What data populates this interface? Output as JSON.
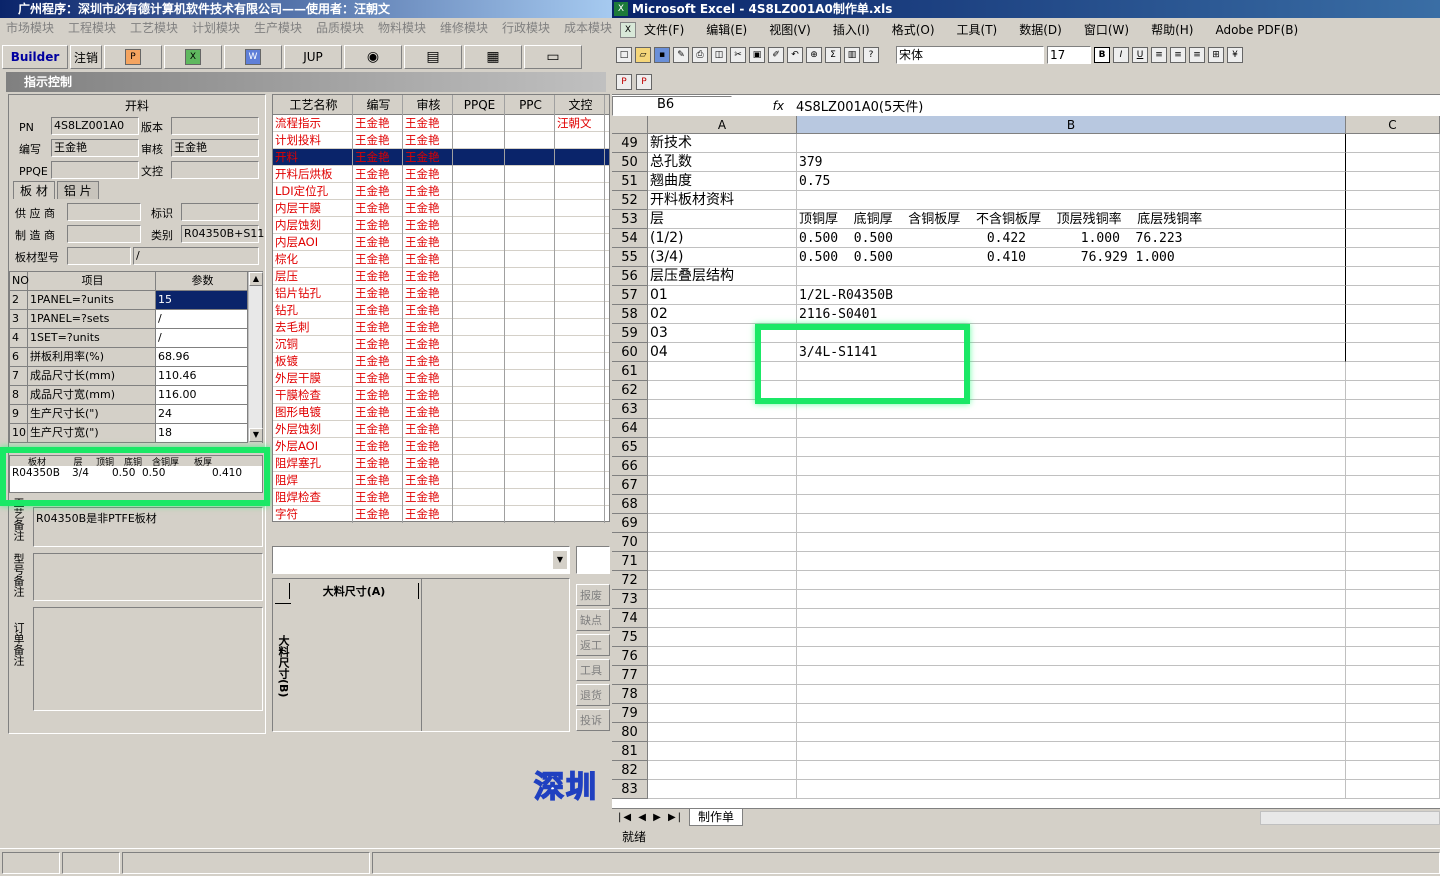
{
  "left": {
    "title": "广州程序：深圳市必有德计算机软件技术有限公司——使用者：汪朝文",
    "menu": [
      "市场模块",
      "工程模块",
      "工艺模块",
      "计划模块",
      "生产模块",
      "品质模块",
      "物料模块",
      "维修模块",
      "行政模块",
      "成本模块"
    ],
    "toolbar": {
      "builder": "Builder",
      "cancel": "注销",
      "jup": "JUP"
    },
    "panel_title": "指示控制",
    "kailiao_header": "开料",
    "form": {
      "pn_label": "PN",
      "pn_value": "4S8LZ001A0",
      "version_label": "版本",
      "editor_label": "编写",
      "editor_value": "王金艳",
      "reviewer_label": "审核",
      "reviewer_value": "王金艳",
      "ppqe_label": "PPQE",
      "wenkong_label": "文控"
    },
    "tabs": [
      "板 材",
      "铝 片"
    ],
    "supplier_label": "供 应 商",
    "mark_label": "标识",
    "maker_label": "制 造 商",
    "type_label": "类别",
    "type_value": "R04350B+S11",
    "model_label": "板材型号",
    "model_value": "/",
    "params_headers": [
      "NO",
      "项目",
      "参数"
    ],
    "params": [
      {
        "no": "2",
        "item": "1PANEL=?units",
        "val": "15"
      },
      {
        "no": "3",
        "item": "1PANEL=?sets",
        "val": "/"
      },
      {
        "no": "4",
        "item": "1SET=?units",
        "val": "/"
      },
      {
        "no": "6",
        "item": "拼板利用率(%)",
        "val": "68.96"
      },
      {
        "no": "7",
        "item": "成品尺寸长(mm)",
        "val": "110.46"
      },
      {
        "no": "8",
        "item": "成品尺寸宽(mm)",
        "val": "116.00"
      },
      {
        "no": "9",
        "item": "生产尺寸长(\")",
        "val": "24"
      },
      {
        "no": "10",
        "item": "生产尺寸宽(\")",
        "val": "18"
      }
    ],
    "mat_headers": [
      "板材",
      "层",
      "顶铜",
      "底铜",
      "含铜厚",
      "板厚"
    ],
    "mat_row": {
      "board": "R04350B",
      "layer": "3/4",
      "top": "0.50",
      "bottom": "0.50",
      "thick": "0.410"
    },
    "note1": "R04350B是非PTFE板材",
    "side_labels": [
      "工艺备注",
      "型号备注",
      "订单备注"
    ],
    "proc_headers": [
      "工艺名称",
      "编写",
      "审核",
      "PPQE",
      "PPC",
      "文控"
    ],
    "processes": [
      "流程指示",
      "计划投料",
      "开料",
      "开料后烘板",
      "LDI定位孔",
      "内层干膜",
      "内层蚀刻",
      "内层AOI",
      "棕化",
      "层压",
      "铝片钻孔",
      "钻孔",
      "去毛刺",
      "沉铜",
      "板镀",
      "外层干膜",
      "干膜检查",
      "图形电镀",
      "外层蚀刻",
      "外层AOI",
      "阻焊塞孔",
      "阻焊",
      "阻焊检查",
      "字符"
    ],
    "proc_person": "王金艳",
    "proc_wenkong": "汪朝文",
    "size_a": "大料尺寸(A)",
    "size_b": "大料尺寸(B)",
    "side_buttons": [
      "报废",
      "缺点",
      "返工",
      "工具",
      "退货",
      "投诉"
    ],
    "watermark": "深圳"
  },
  "excel": {
    "title": "Microsoft Excel - 4S8LZ001A0制作单.xls",
    "menu": [
      "文件(F)",
      "编辑(E)",
      "视图(V)",
      "插入(I)",
      "格式(O)",
      "工具(T)",
      "数据(D)",
      "窗口(W)",
      "帮助(H)",
      "Adobe PDF(B)"
    ],
    "font_name": "宋体",
    "font_size": "17",
    "cell_ref": "B6",
    "formula": "4S8LZ001A0(5天件)",
    "columns": [
      "A",
      "B",
      "C"
    ],
    "rows": [
      {
        "n": "49",
        "a": "新技术",
        "b": ""
      },
      {
        "n": "50",
        "a": "总孔数",
        "b": "379"
      },
      {
        "n": "51",
        "a": "翘曲度",
        "b": "0.75"
      },
      {
        "n": "52",
        "a": "开料板材资料",
        "b": ""
      },
      {
        "n": "53",
        "a": "层",
        "b": "顶铜厚  底铜厚  含铜板厚  不含铜板厚  顶层残铜率  底层残铜率"
      },
      {
        "n": "54",
        "a": "(1/2)",
        "b": "0.500  0.500            0.422       1.000  76.223"
      },
      {
        "n": "55",
        "a": "(3/4)",
        "b": "0.500  0.500            0.410       76.929 1.000"
      },
      {
        "n": "56",
        "a": "层压叠层结构",
        "b": ""
      },
      {
        "n": "57",
        "a": "01",
        "b": "1/2L-R04350B"
      },
      {
        "n": "58",
        "a": "02",
        "b": "2116-S0401"
      },
      {
        "n": "59",
        "a": "03",
        "b": ""
      },
      {
        "n": "60",
        "a": "04",
        "b": "3/4L-S1141"
      },
      {
        "n": "61",
        "a": "",
        "b": ""
      },
      {
        "n": "62",
        "a": "",
        "b": ""
      },
      {
        "n": "63",
        "a": "",
        "b": ""
      },
      {
        "n": "64",
        "a": "",
        "b": ""
      },
      {
        "n": "65",
        "a": "",
        "b": ""
      },
      {
        "n": "66",
        "a": "",
        "b": ""
      },
      {
        "n": "67",
        "a": "",
        "b": ""
      },
      {
        "n": "68",
        "a": "",
        "b": ""
      },
      {
        "n": "69",
        "a": "",
        "b": ""
      },
      {
        "n": "70",
        "a": "",
        "b": ""
      },
      {
        "n": "71",
        "a": "",
        "b": ""
      },
      {
        "n": "72",
        "a": "",
        "b": ""
      },
      {
        "n": "73",
        "a": "",
        "b": ""
      },
      {
        "n": "74",
        "a": "",
        "b": ""
      },
      {
        "n": "75",
        "a": "",
        "b": ""
      },
      {
        "n": "76",
        "a": "",
        "b": ""
      },
      {
        "n": "77",
        "a": "",
        "b": ""
      },
      {
        "n": "78",
        "a": "",
        "b": ""
      },
      {
        "n": "79",
        "a": "",
        "b": ""
      },
      {
        "n": "80",
        "a": "",
        "b": ""
      },
      {
        "n": "81",
        "a": "",
        "b": ""
      },
      {
        "n": "82",
        "a": "",
        "b": ""
      },
      {
        "n": "83",
        "a": "",
        "b": ""
      }
    ],
    "sheet_tab": "制作单",
    "status": "就绪"
  },
  "colors": {
    "highlight": "#1ae866",
    "selected_row": "#0a246a",
    "proc_red": "#e00000"
  }
}
